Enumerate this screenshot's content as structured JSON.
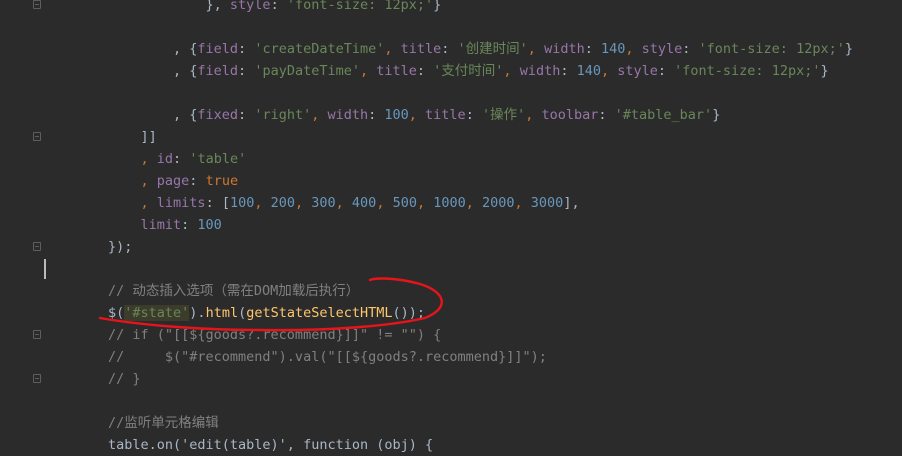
{
  "editor": {
    "lines": [
      [
        {
          "t": "            }, ",
          "c": ""
        },
        {
          "t": "style",
          "c": "prop"
        },
        {
          "t": ": ",
          "c": ""
        },
        {
          "t": "'font-size: 12px;'",
          "c": "str"
        },
        {
          "t": "}",
          "c": ""
        }
      ],
      [],
      [
        {
          "t": "        , {",
          "c": ""
        },
        {
          "t": "field",
          "c": "prop"
        },
        {
          "t": ": ",
          "c": ""
        },
        {
          "t": "'createDateTime'",
          "c": "str"
        },
        {
          "t": ", ",
          "c": "kw"
        },
        {
          "t": "title",
          "c": "prop"
        },
        {
          "t": ": ",
          "c": ""
        },
        {
          "t": "'创建时间'",
          "c": "str"
        },
        {
          "t": ", ",
          "c": "kw"
        },
        {
          "t": "width",
          "c": "prop"
        },
        {
          "t": ": ",
          "c": ""
        },
        {
          "t": "140",
          "c": "num"
        },
        {
          "t": ", ",
          "c": "kw"
        },
        {
          "t": "style",
          "c": "prop"
        },
        {
          "t": ": ",
          "c": ""
        },
        {
          "t": "'font-size: 12px;'",
          "c": "str"
        },
        {
          "t": "}",
          "c": ""
        }
      ],
      [
        {
          "t": "        , {",
          "c": ""
        },
        {
          "t": "field",
          "c": "prop"
        },
        {
          "t": ": ",
          "c": ""
        },
        {
          "t": "'payDateTime'",
          "c": "str"
        },
        {
          "t": ", ",
          "c": "kw"
        },
        {
          "t": "title",
          "c": "prop"
        },
        {
          "t": ": ",
          "c": ""
        },
        {
          "t": "'支付时间'",
          "c": "str"
        },
        {
          "t": ", ",
          "c": "kw"
        },
        {
          "t": "width",
          "c": "prop"
        },
        {
          "t": ": ",
          "c": ""
        },
        {
          "t": "140",
          "c": "num"
        },
        {
          "t": ", ",
          "c": "kw"
        },
        {
          "t": "style",
          "c": "prop"
        },
        {
          "t": ": ",
          "c": ""
        },
        {
          "t": "'font-size: 12px;'",
          "c": "str"
        },
        {
          "t": "}",
          "c": ""
        }
      ],
      [],
      [
        {
          "t": "        , {",
          "c": ""
        },
        {
          "t": "fixed",
          "c": "prop"
        },
        {
          "t": ": ",
          "c": ""
        },
        {
          "t": "'right'",
          "c": "str"
        },
        {
          "t": ", ",
          "c": "kw"
        },
        {
          "t": "width",
          "c": "prop"
        },
        {
          "t": ": ",
          "c": ""
        },
        {
          "t": "100",
          "c": "num"
        },
        {
          "t": ", ",
          "c": "kw"
        },
        {
          "t": "title",
          "c": "prop"
        },
        {
          "t": ": ",
          "c": ""
        },
        {
          "t": "'操作'",
          "c": "str"
        },
        {
          "t": ", ",
          "c": "kw"
        },
        {
          "t": "toolbar",
          "c": "prop"
        },
        {
          "t": ": ",
          "c": ""
        },
        {
          "t": "'#table_bar'",
          "c": "str"
        },
        {
          "t": "}",
          "c": ""
        }
      ],
      [
        {
          "t": "    ]]",
          "c": ""
        }
      ],
      [
        {
          "t": "    , ",
          "c": "kw"
        },
        {
          "t": "id",
          "c": "prop"
        },
        {
          "t": ": ",
          "c": ""
        },
        {
          "t": "'table'",
          "c": "str"
        }
      ],
      [
        {
          "t": "    , ",
          "c": "kw"
        },
        {
          "t": "page",
          "c": "prop"
        },
        {
          "t": ": ",
          "c": ""
        },
        {
          "t": "true",
          "c": "kw"
        }
      ],
      [
        {
          "t": "    , ",
          "c": "kw"
        },
        {
          "t": "limits",
          "c": "prop"
        },
        {
          "t": ": [",
          "c": ""
        },
        {
          "t": "100",
          "c": "num"
        },
        {
          "t": ", ",
          "c": "kw"
        },
        {
          "t": "200",
          "c": "num"
        },
        {
          "t": ", ",
          "c": "kw"
        },
        {
          "t": "300",
          "c": "num"
        },
        {
          "t": ", ",
          "c": "kw"
        },
        {
          "t": "400",
          "c": "num"
        },
        {
          "t": ", ",
          "c": "kw"
        },
        {
          "t": "500",
          "c": "num"
        },
        {
          "t": ", ",
          "c": "kw"
        },
        {
          "t": "1000",
          "c": "num"
        },
        {
          "t": ", ",
          "c": "kw"
        },
        {
          "t": "2000",
          "c": "num"
        },
        {
          "t": ", ",
          "c": "kw"
        },
        {
          "t": "3000",
          "c": "num"
        },
        {
          "t": "],",
          "c": ""
        }
      ],
      [
        {
          "t": "    ",
          "c": ""
        },
        {
          "t": "limit",
          "c": "prop"
        },
        {
          "t": ": ",
          "c": ""
        },
        {
          "t": "100",
          "c": "num"
        }
      ],
      [
        {
          "t": "});",
          "c": ""
        }
      ],
      [],
      [
        {
          "t": "// 动态插入选项（需在DOM加载后执行）",
          "c": "cmt"
        }
      ],
      [
        {
          "t": "$(",
          "c": ""
        },
        {
          "t": "'#state'",
          "c": "str hl"
        },
        {
          "t": ").",
          "c": ""
        },
        {
          "t": "html",
          "c": "fn"
        },
        {
          "t": "(",
          "c": ""
        },
        {
          "t": "getStateSelectHTML",
          "c": "fn"
        },
        {
          "t": "());",
          "c": ""
        }
      ],
      [
        {
          "t": "// if (\"[[${goods?.recommend}]]\" != \"\") {",
          "c": "cmt"
        }
      ],
      [
        {
          "t": "//     $(\"#recommend\").val(\"[[${goods?.recommend}]]\");",
          "c": "cmt"
        }
      ],
      [
        {
          "t": "// }",
          "c": "cmt"
        }
      ],
      [],
      [
        {
          "t": "//监听单元格编辑",
          "c": "cmt"
        }
      ],
      [
        {
          "t": "table.on('edit(table)', function (obj) {",
          "c": ""
        }
      ]
    ]
  },
  "annotation": {
    "stroke_color": "#e8141b"
  }
}
